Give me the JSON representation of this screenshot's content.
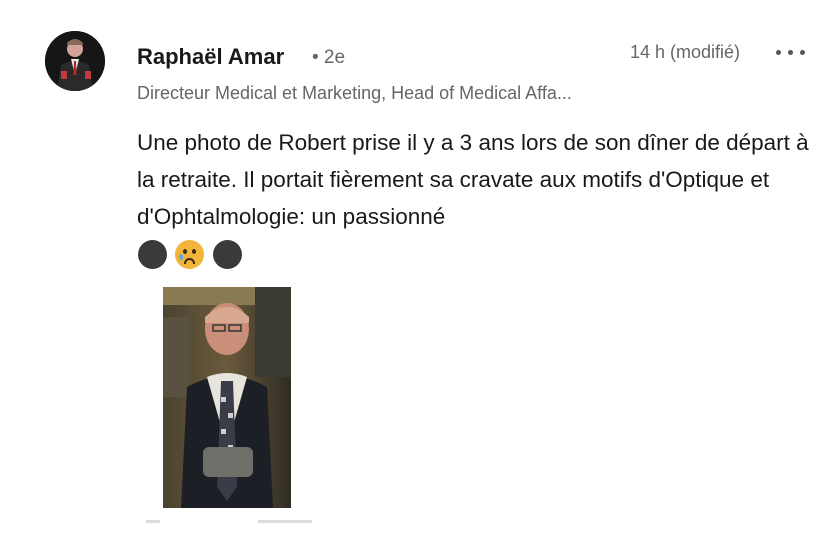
{
  "post": {
    "author": {
      "name": "Raphaël Amar",
      "degree": "• 2e",
      "headline": "Directeur Medical et Marketing, Head of Medical Affa..."
    },
    "timestamp": "14 h (modifié)",
    "more_icon": "ellipsis-horizontal-icon",
    "text": "Une photo de Robert prise il y a 3 ans lors de son dîner de départ à la retraite. Il portait fièrement sa cravate aux motifs d'Optique et d'Ophtalmologie: un passionné",
    "emojis": [
      "black-circle-emoji",
      "crying-face-emoji",
      "black-circle-emoji"
    ]
  },
  "colors": {
    "name": "#1a1a1a",
    "meta": "#666666",
    "body_text": "#1a1a1a"
  }
}
